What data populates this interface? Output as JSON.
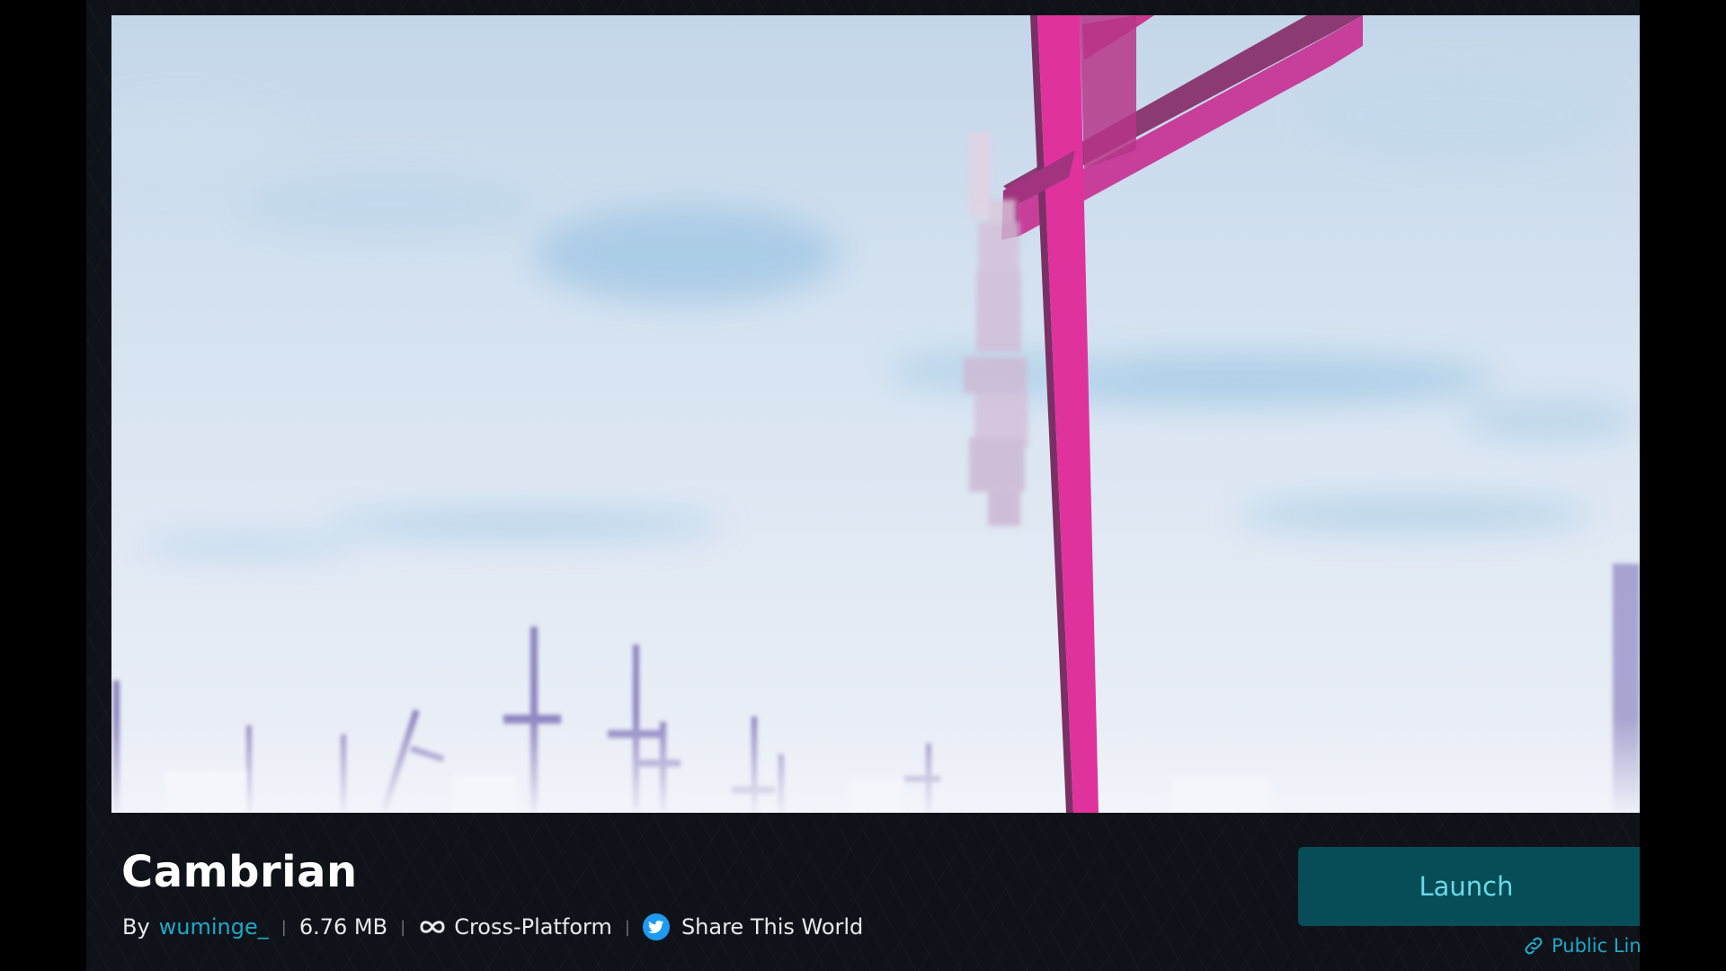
{
  "world": {
    "title": "Cambrian",
    "by_label": "By",
    "author": "wuminge_",
    "size": "6.76 MB",
    "platform": "Cross-Platform",
    "share": "Share This World"
  },
  "actions": {
    "launch": "Launch",
    "public_link": "Public Link"
  },
  "icons": {
    "platform": "infinity-icon",
    "share": "twitter-bird-icon",
    "public_link": "link-chain-icon"
  },
  "colors": {
    "page_background": "#0f1218",
    "accent": "#1ea9c9",
    "launch_background": "#064d57",
    "launch_text": "#6ad9e8",
    "cross_magenta": "#e6379e",
    "twitter_blue": "#1d9bf0"
  }
}
